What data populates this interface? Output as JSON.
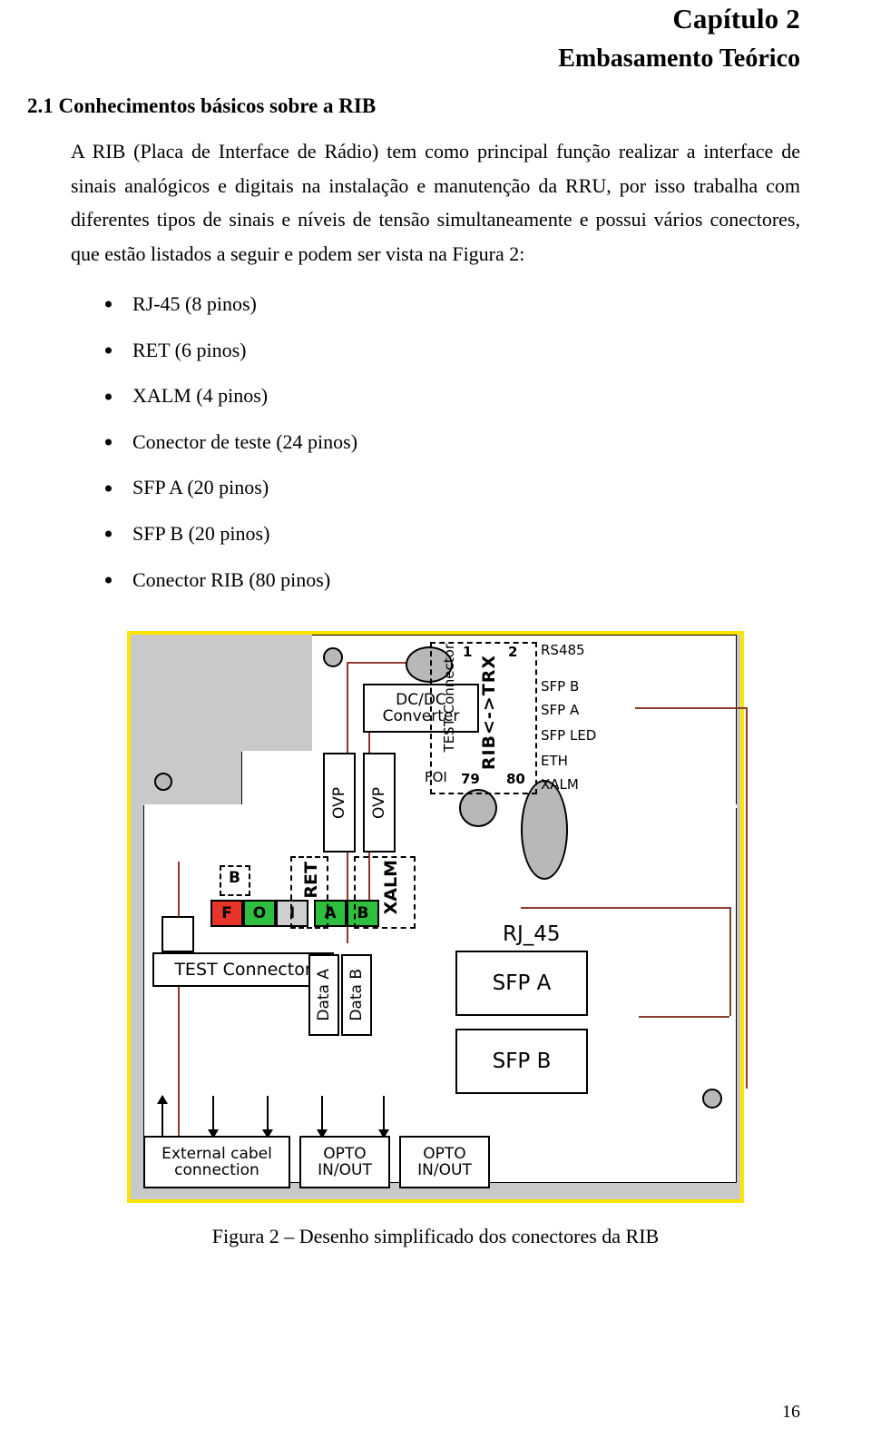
{
  "header": {
    "chapter": "Capítulo 2",
    "chapter_subtitle": "Embasamento Teórico"
  },
  "section": {
    "number_title": "2.1 Conhecimentos básicos sobre a RIB"
  },
  "body": {
    "paragraph": "A RIB (Placa de Interface de Rádio) tem como principal função realizar a interface de sinais analógicos e digitais na instalação e manutenção da RRU, por isso trabalha com diferentes tipos de sinais e níveis de tensão simultaneamente e possui vários conectores, que estão listados a seguir e podem ser vista na Figura 2:"
  },
  "connectors": [
    "RJ-45 (8 pinos)",
    "RET (6 pinos)",
    "XALM (4 pinos)",
    "Conector de teste (24 pinos)",
    "SFP A (20 pinos)",
    "SFP B (20 pinos)",
    "Conector RIB (80 pinos)"
  ],
  "figure": {
    "caption": "Figura 2 – Desenho simplificado dos conectores da RIB",
    "labels": {
      "dcdc": "DC/DC\nConverter",
      "dcdc_line1": "DC/DC",
      "dcdc_line2": "Converter",
      "ovp_a": "OVP",
      "ovp_b": "OVP",
      "test_connector_vertical": "TEST Connector",
      "rib_trx": "RIB<->TRX",
      "pin_1": "1",
      "pin_2": "2",
      "pin_79": "79",
      "pin_80": "80",
      "foi_label": "FOI",
      "rs485": "RS485",
      "sfp_b_right": "SFP B",
      "sfp_a_right": "SFP A",
      "sfp_led": "SFP LED",
      "eth": "ETH",
      "xalm_right": "XALM",
      "b_small": "B",
      "f_chip": "F",
      "o_chip": "O",
      "i_chip": "I",
      "a_chip": "A",
      "b_chip": "B",
      "ret_vertical": "RET",
      "xalm_vertical": "XALM",
      "test_connector_box": "TEST Connector",
      "data_a": "Data A",
      "data_b": "Data B",
      "rj_45": "RJ_45",
      "sfp_a_box": "SFP A",
      "sfp_b_box": "SFP B",
      "external_cable_line1": "External cabel",
      "external_cable_line2": "connection",
      "opto_1_line1": "OPTO",
      "opto_1_line2": "IN/OUT",
      "opto_2_line1": "OPTO",
      "opto_2_line2": "IN/OUT"
    },
    "colors": {
      "border": "#ffe400",
      "background": "#c9c9c9",
      "wire": "#8b3a2e",
      "chip_f": "#e8352a",
      "chip_o": "#2fbf3f",
      "chip_i": "#cfcfcf",
      "chip_a": "#2fbf3f",
      "chip_b": "#2fbf3f"
    }
  },
  "footer": {
    "page_number": "16"
  }
}
